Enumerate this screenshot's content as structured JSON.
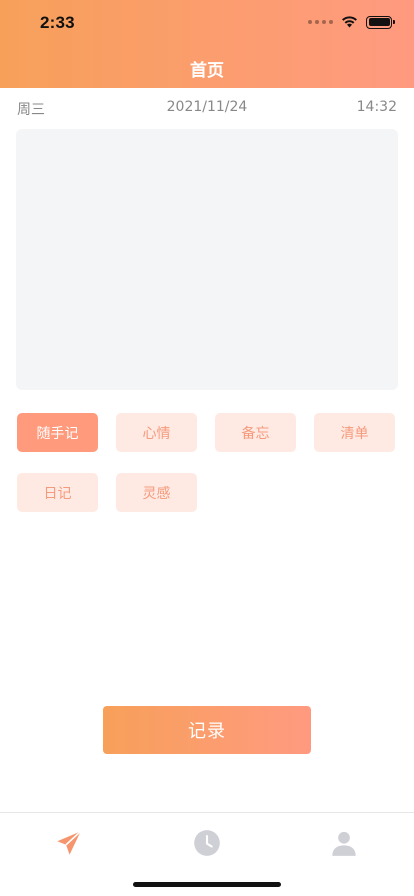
{
  "status_bar": {
    "time": "2:33"
  },
  "header": {
    "title": "首页"
  },
  "info_row": {
    "weekday": "周三",
    "date": "2021/11/24",
    "time": "14:32"
  },
  "editor": {
    "value": "",
    "placeholder": ""
  },
  "tags": [
    {
      "label": "随手记",
      "selected": true
    },
    {
      "label": "心情",
      "selected": false
    },
    {
      "label": "备忘",
      "selected": false
    },
    {
      "label": "清单",
      "selected": false
    },
    {
      "label": "日记",
      "selected": false
    },
    {
      "label": "灵感",
      "selected": false
    }
  ],
  "actions": {
    "record_label": "记录"
  },
  "tabbar": {
    "items": [
      {
        "icon": "paper-plane-icon",
        "active": true
      },
      {
        "icon": "clock-icon",
        "active": false
      },
      {
        "icon": "person-icon",
        "active": false
      }
    ],
    "active_color": "#f6956d",
    "inactive_color": "#cfd0d6"
  },
  "colors": {
    "accent_start": "#f7a05a",
    "accent_end": "#ff9a80",
    "tag_bg": "#ffeae3",
    "tag_text": "#f59a7c",
    "tag_active_bg": "#ff9a7c"
  }
}
